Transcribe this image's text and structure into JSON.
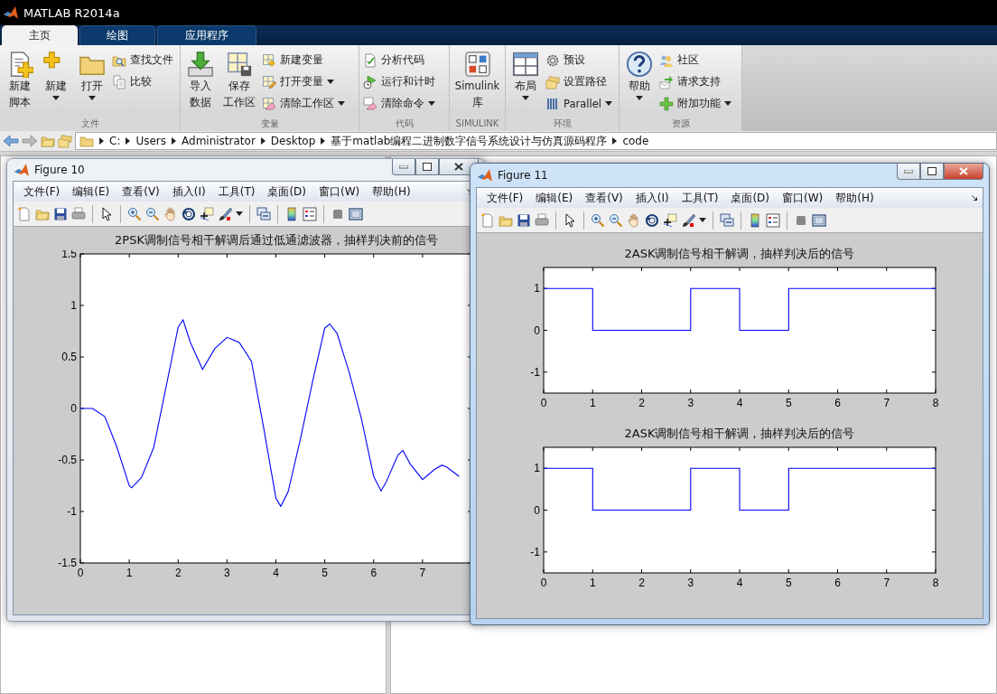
{
  "window": {
    "title": "MATLAB R2014a"
  },
  "tabs": [
    {
      "label": "主页",
      "selected": true
    },
    {
      "label": "绘图",
      "selected": false
    },
    {
      "label": "应用程序",
      "selected": false
    }
  ],
  "toolstrip": [
    {
      "label": "文件",
      "items": [
        {
          "kind": "large",
          "lines": [
            "新建",
            "脚本"
          ],
          "dropdown": false
        },
        {
          "kind": "large",
          "lines": [
            "新建"
          ],
          "dropdown": true
        },
        {
          "kind": "large",
          "lines": [
            "打开"
          ],
          "dropdown": true
        },
        {
          "kind": "stack",
          "items": [
            {
              "label": "查找文件",
              "dropdown": false
            },
            {
              "label": "比较",
              "dropdown": false
            }
          ]
        }
      ]
    },
    {
      "label": "变量",
      "items": [
        {
          "kind": "large",
          "lines": [
            "导入",
            "数据"
          ],
          "dropdown": false
        },
        {
          "kind": "large",
          "lines": [
            "保存",
            "工作区"
          ],
          "dropdown": false
        },
        {
          "kind": "stack",
          "items": [
            {
              "label": "新建变量",
              "dropdown": false
            },
            {
              "label": "打开变量",
              "dropdown": true
            },
            {
              "label": "清除工作区",
              "dropdown": true
            }
          ]
        }
      ]
    },
    {
      "label": "代码",
      "items": [
        {
          "kind": "stack",
          "items": [
            {
              "label": "分析代码",
              "dropdown": false
            },
            {
              "label": "运行和计时",
              "dropdown": false
            },
            {
              "label": "清除命令",
              "dropdown": true
            }
          ]
        }
      ]
    },
    {
      "label": "SIMULINK",
      "items": [
        {
          "kind": "large",
          "lines": [
            "Simulink",
            "库"
          ],
          "dropdown": false
        }
      ]
    },
    {
      "label": "环境",
      "items": [
        {
          "kind": "large",
          "lines": [
            "布局"
          ],
          "dropdown": true
        },
        {
          "kind": "stack",
          "items": [
            {
              "label": "预设",
              "dropdown": false
            },
            {
              "label": "设置路径",
              "dropdown": false
            },
            {
              "label": "Parallel",
              "dropdown": true
            }
          ]
        }
      ]
    },
    {
      "label": "资源",
      "items": [
        {
          "kind": "large",
          "lines": [
            "帮助"
          ],
          "dropdown": true
        },
        {
          "kind": "stack",
          "items": [
            {
              "label": "社区",
              "dropdown": false
            },
            {
              "label": "请求支持",
              "dropdown": false
            },
            {
              "label": "附加功能",
              "dropdown": true
            }
          ]
        }
      ]
    }
  ],
  "address_bar": {
    "path": [
      "C:",
      "Users",
      "Administrator",
      "Desktop",
      "基于matlab编程二进制数字信号系统设计与仿真源码程序",
      "code"
    ]
  },
  "figures": [
    {
      "title": "Figure 10",
      "active": false,
      "menu": [
        "文件(F)",
        "编辑(E)",
        "查看(V)",
        "插入(I)",
        "工具(T)",
        "桌面(D)",
        "窗口(W)",
        "帮助(H)"
      ],
      "axes": [
        {
          "title": "2PSK调制信号相干解调后通过低通滤波器，抽样判决前的信号",
          "chart_data": {
            "type": "line",
            "x": [
              0,
              0.25,
              0.5,
              0.75,
              1,
              1.05,
              1.25,
              1.5,
              1.75,
              2,
              2.1,
              2.25,
              2.5,
              2.75,
              3,
              3.25,
              3.5,
              3.75,
              4,
              4.1,
              4.25,
              4.5,
              4.75,
              5,
              5.1,
              5.25,
              5.5,
              5.75,
              6,
              6.15,
              6.25,
              6.5,
              6.6,
              6.75,
              7,
              7.25,
              7.4,
              7.5,
              7.75
            ],
            "series": [
              {
                "color": "#0000ff",
                "values": [
                  0,
                  0,
                  -0.08,
                  -0.38,
                  -0.75,
                  -0.77,
                  -0.67,
                  -0.38,
                  0.2,
                  0.79,
                  0.86,
                  0.64,
                  0.38,
                  0.58,
                  0.69,
                  0.64,
                  0.46,
                  -0.19,
                  -0.87,
                  -0.95,
                  -0.81,
                  -0.3,
                  0.26,
                  0.78,
                  0.82,
                  0.73,
                  0.35,
                  -0.1,
                  -0.66,
                  -0.8,
                  -0.72,
                  -0.45,
                  -0.41,
                  -0.54,
                  -0.69,
                  -0.59,
                  -0.55,
                  -0.57,
                  -0.66
                ]
              }
            ],
            "xlim": [
              0,
              8
            ],
            "ylim": [
              -1.5,
              1.5
            ],
            "xticks": [
              0,
              1,
              2,
              3,
              4,
              5,
              6,
              7
            ],
            "yticks": [
              -1.5,
              -1,
              -0.5,
              0,
              0.5,
              1,
              1.5
            ]
          }
        }
      ]
    },
    {
      "title": "Figure 11",
      "active": true,
      "menu": [
        "文件(F)",
        "编辑(E)",
        "查看(V)",
        "插入(I)",
        "工具(T)",
        "桌面(D)",
        "窗口(W)",
        "帮助(H)"
      ],
      "axes": [
        {
          "title": "2ASK调制信号相干解调，抽样判决后的信号",
          "chart_data": {
            "type": "line",
            "x": [
              0,
              1,
              1,
              3,
              3,
              4,
              4,
              5,
              5,
              8
            ],
            "series": [
              {
                "color": "#0000ff",
                "values": [
                  1,
                  1,
                  0,
                  0,
                  1,
                  1,
                  0,
                  0,
                  1,
                  1
                ]
              }
            ],
            "xlim": [
              0,
              8
            ],
            "ylim": [
              -1.5,
              1.5
            ],
            "xticks": [
              0,
              1,
              2,
              3,
              4,
              5,
              6,
              7,
              8
            ],
            "yticks": [
              -1,
              0,
              1
            ]
          }
        },
        {
          "title": "2ASK调制信号相干解调，抽样判决后的信号",
          "chart_data": {
            "type": "line",
            "x": [
              0,
              1,
              1,
              3,
              3,
              4,
              4,
              5,
              5,
              8
            ],
            "series": [
              {
                "color": "#0000ff",
                "values": [
                  1,
                  1,
                  0,
                  0,
                  1,
                  1,
                  0,
                  0,
                  1,
                  1
                ]
              }
            ],
            "xlim": [
              0,
              8
            ],
            "ylim": [
              -1.5,
              1.5
            ],
            "xticks": [
              0,
              1,
              2,
              3,
              4,
              5,
              6,
              7,
              8
            ],
            "yticks": [
              -1,
              0,
              1
            ]
          }
        }
      ]
    }
  ]
}
